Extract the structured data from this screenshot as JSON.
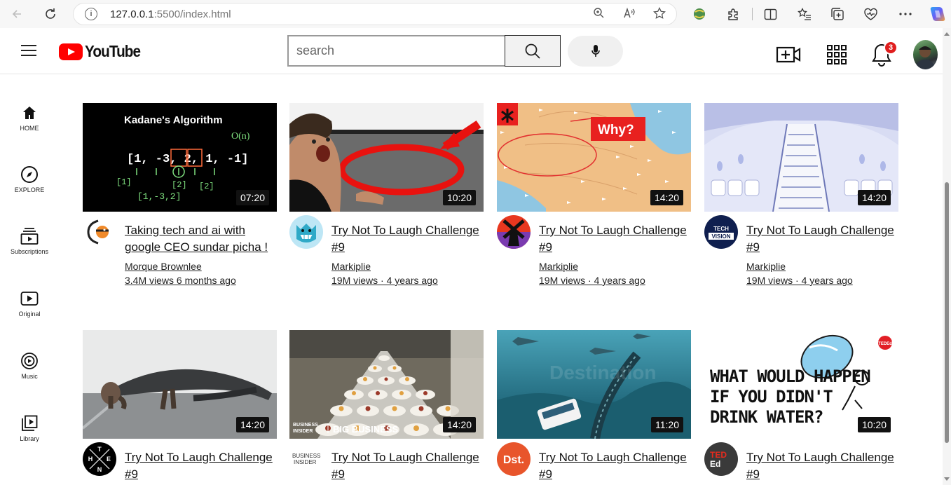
{
  "browser": {
    "url_host": "127.0.0.1",
    "url_rest": ":5500/index.html"
  },
  "header": {
    "logo_text": "YouTube",
    "search_placeholder": "search",
    "notification_count": "3"
  },
  "sidebar": {
    "items": [
      {
        "label": "HOME",
        "icon": "home-icon"
      },
      {
        "label": "EXPLORE",
        "icon": "compass-icon"
      },
      {
        "label": "Subscriptions",
        "icon": "subscriptions-icon"
      },
      {
        "label": "Original",
        "icon": "original-icon"
      },
      {
        "label": "Music",
        "icon": "music-icon"
      },
      {
        "label": "Library",
        "icon": "library-icon"
      }
    ]
  },
  "videos": [
    {
      "title": "Taking tech and ai with google CEO sundar picha !",
      "channel": "Morque Brownlee",
      "meta": "3.4M views 6 months ago",
      "duration": "07:20",
      "thumb_text": "Kadane's Algorithm"
    },
    {
      "title": "Try Not To Laugh Challenge #9",
      "channel": "Markiplie",
      "meta": "19M views · 4 years ago",
      "duration": "10:20"
    },
    {
      "title": "Try Not To Laugh Challenge #9",
      "channel": "Markiplie",
      "meta": "19M views · 4 years ago",
      "duration": "14:20",
      "thumb_text": "Why?"
    },
    {
      "title": "Try Not To Laugh Challenge #9",
      "channel": "Markiplie",
      "meta": "19M views · 4 years ago",
      "duration": "14:20",
      "avatar_text": "TECH VISION"
    },
    {
      "title": "Try Not To Laugh Challenge #9",
      "duration": "14:20",
      "avatar_text": "T H E N"
    },
    {
      "title": "Try Not To Laugh Challenge #9",
      "duration": "14:20",
      "thumb_text": "BIG BUSINESS",
      "avatar_text": "BUSINESS INSIDER"
    },
    {
      "title": "Try Not To Laugh Challenge #9",
      "duration": "11:20",
      "avatar_text": "Dst."
    },
    {
      "title": "Try Not To Laugh Challenge #9",
      "duration": "10:20",
      "thumb_text": "WHAT WOULD HAPPEN IF YOU DIDN'T DRINK WATER?",
      "avatar_text": "TED Ed"
    }
  ]
}
